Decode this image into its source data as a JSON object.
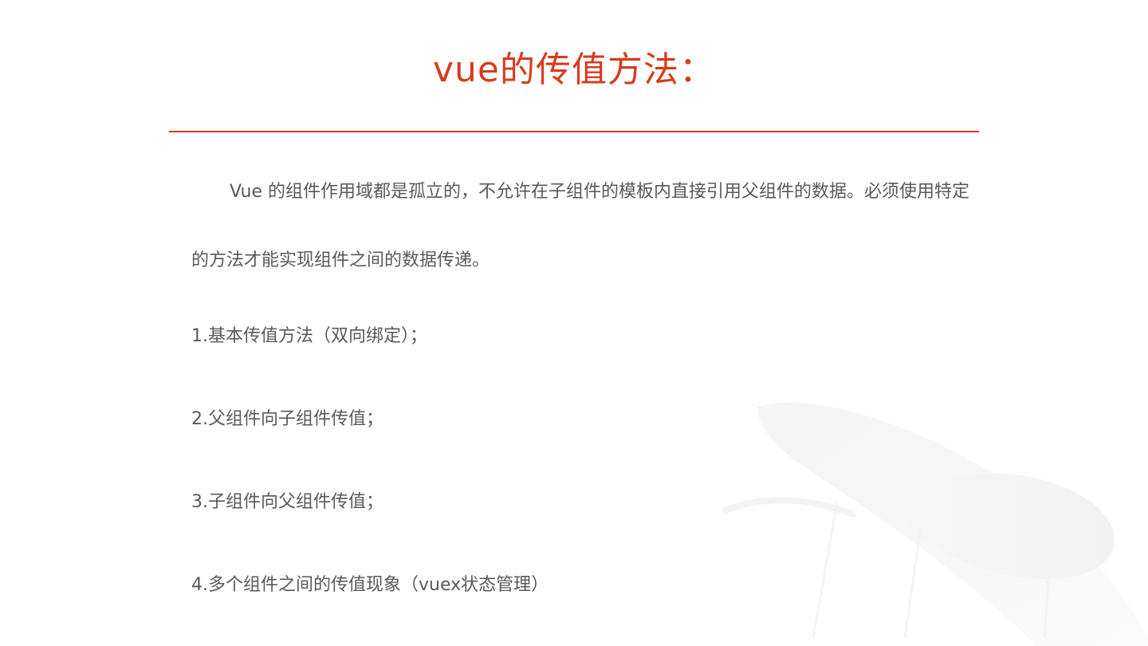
{
  "slide": {
    "title": "vue的传值方法：",
    "intro": "Vue 的组件作用域都是孤立的，不允许在子组件的模板内直接引用父组件的数据。必须使用特定的方法才能实现组件之间的数据传递。",
    "items": [
      "1.基本传值方法（双向绑定）；",
      "2.父组件向子组件传值；",
      "3.子组件向父组件传值；",
      "4.多个组件之间的传值现象（vuex状态管理）"
    ]
  },
  "colors": {
    "accent": "#d83a1d",
    "body_text": "#595959",
    "background": "#ffffff"
  }
}
